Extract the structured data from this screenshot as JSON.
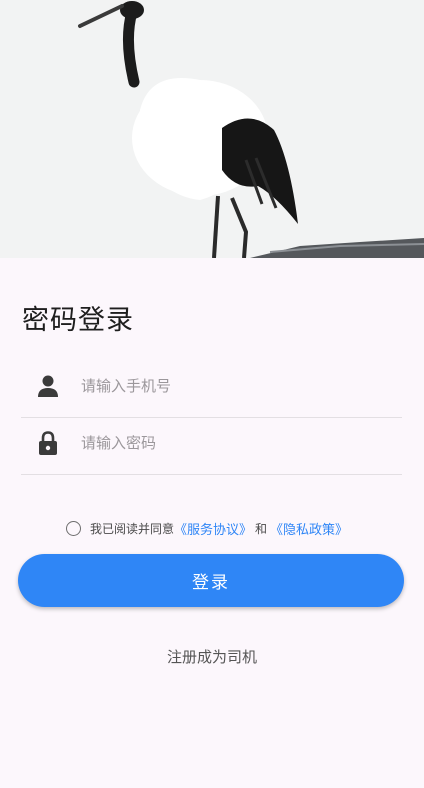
{
  "page": {
    "title": "密码登录"
  },
  "phone": {
    "placeholder": "请输入手机号",
    "value": ""
  },
  "password": {
    "placeholder": "请输入密码",
    "value": ""
  },
  "agreement": {
    "checked": false,
    "prefix": "我已阅读并同意",
    "service_link": "《服务协议》",
    "and_text": "和",
    "privacy_link": "《隐私政策》"
  },
  "login_button": {
    "label": "登录"
  },
  "register_link": {
    "label": "注册成为司机"
  },
  "colors": {
    "accent": "#2f86f6",
    "background": "#fcf7fc"
  }
}
